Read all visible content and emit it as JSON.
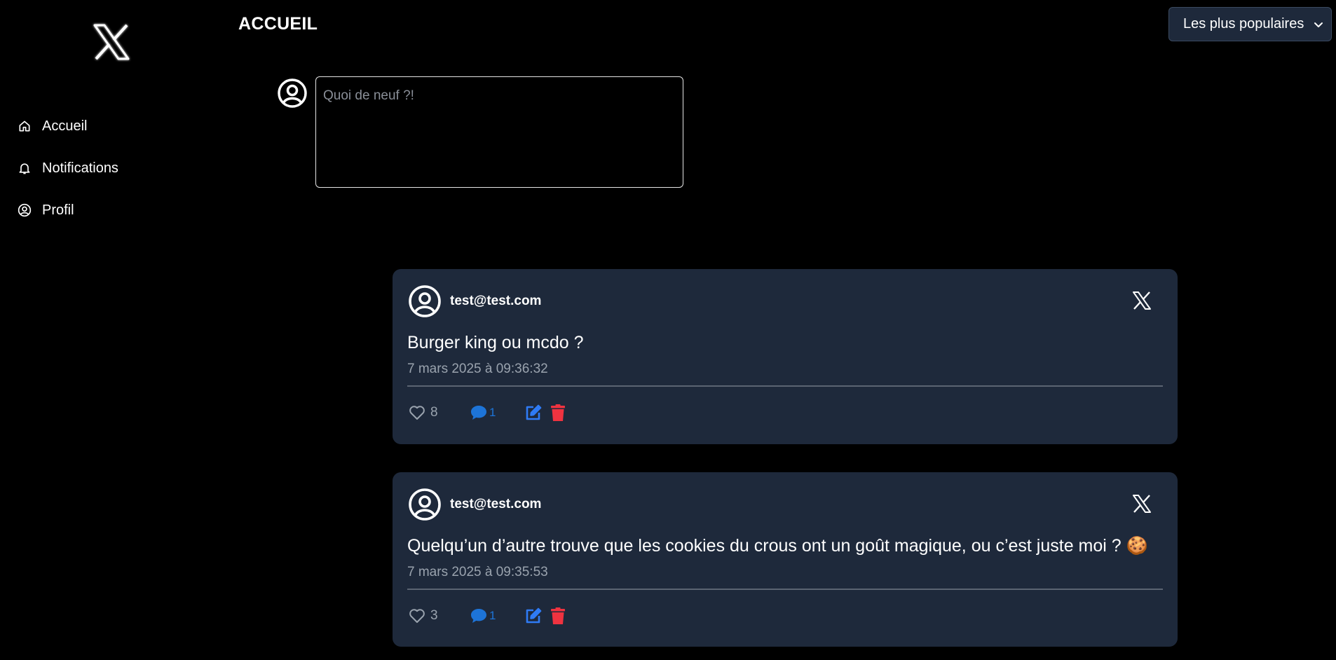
{
  "app": {
    "logo_icon": "x-logo-icon",
    "page_title": "ACCUEIL"
  },
  "sidebar": {
    "items": [
      {
        "label": "Accueil",
        "icon": "home-icon"
      },
      {
        "label": "Notifications",
        "icon": "bell-icon"
      },
      {
        "label": "Profil",
        "icon": "user-circle-icon"
      }
    ]
  },
  "sort": {
    "selected": "Les plus populaires",
    "icon": "chevron-down-icon"
  },
  "composer": {
    "placeholder": "Quoi de neuf ?!",
    "value": ""
  },
  "colors": {
    "background": "#000000",
    "card": "#1e293b",
    "comment_blue": "#1d74d8",
    "edit_blue": "#2f7bf5",
    "delete_red": "#ef3340",
    "muted_text": "#9aa3ae"
  },
  "posts": [
    {
      "author": "test@test.com",
      "text": "Burger king ou mcdo ?",
      "date": "7 mars 2025 à 09:36:32",
      "likes": "8",
      "comments": "1"
    },
    {
      "author": "test@test.com",
      "text": "Quelqu’un d’autre trouve que les cookies du crous ont un goût magique, ou c’est juste moi ? 🍪",
      "date": "7 mars 2025 à 09:35:53",
      "likes": "3",
      "comments": "1"
    }
  ]
}
